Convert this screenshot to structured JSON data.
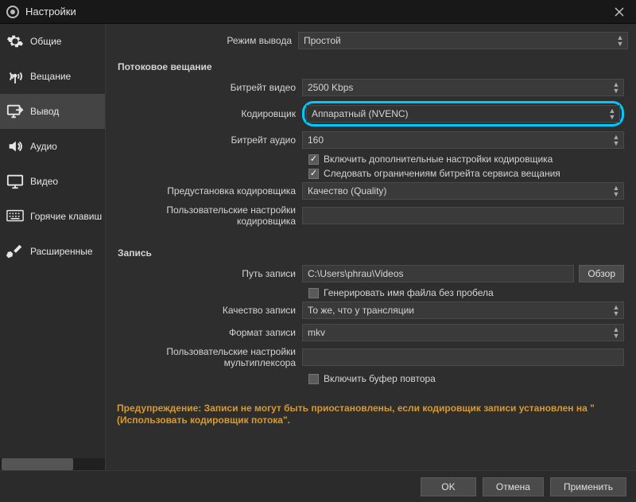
{
  "window": {
    "title": "Настройки"
  },
  "sidebar": {
    "items": [
      {
        "label": "Общие"
      },
      {
        "label": "Вещание"
      },
      {
        "label": "Вывод"
      },
      {
        "label": "Аудио"
      },
      {
        "label": "Видео"
      },
      {
        "label": "Горячие клавиш"
      },
      {
        "label": "Расширенные"
      }
    ]
  },
  "output": {
    "mode_label": "Режим вывода",
    "mode_value": "Простой",
    "streaming": {
      "section_title": "Потоковое вещание",
      "video_bitrate_label": "Битрейт видео",
      "video_bitrate_value": "2500 Kbps",
      "encoder_label": "Кодировщик",
      "encoder_value": "Аппаратный (NVENC)",
      "audio_bitrate_label": "Битрейт аудио",
      "audio_bitrate_value": "160",
      "advanced_check_label": "Включить дополнительные настройки кодировщика",
      "enforce_check_label": "Следовать ограничениям битрейта сервиса вещания",
      "preset_label": "Предустановка кодировщика",
      "preset_value": "Качество (Quality)",
      "custom_label": "Пользовательские настройки кодировщика"
    },
    "recording": {
      "section_title": "Запись",
      "path_label": "Путь записи",
      "path_value": "C:\\Users\\phrau\\Videos",
      "browse_label": "Обзор",
      "nospace_label": "Генерировать имя файла без пробела",
      "quality_label": "Качество записи",
      "quality_value": "То же, что у трансляции",
      "format_label": "Формат записи",
      "format_value": "mkv",
      "muxer_label": "Пользовательские настройки мультиплексора",
      "replay_label": "Включить буфер повтора"
    },
    "warning": "Предупреждение: Записи не могут быть приостановлены, если кодировщик записи установлен на \"(Использовать кодировщик потока\"."
  },
  "buttons": {
    "ok": "OK",
    "cancel": "Отмена",
    "apply": "Применить"
  }
}
